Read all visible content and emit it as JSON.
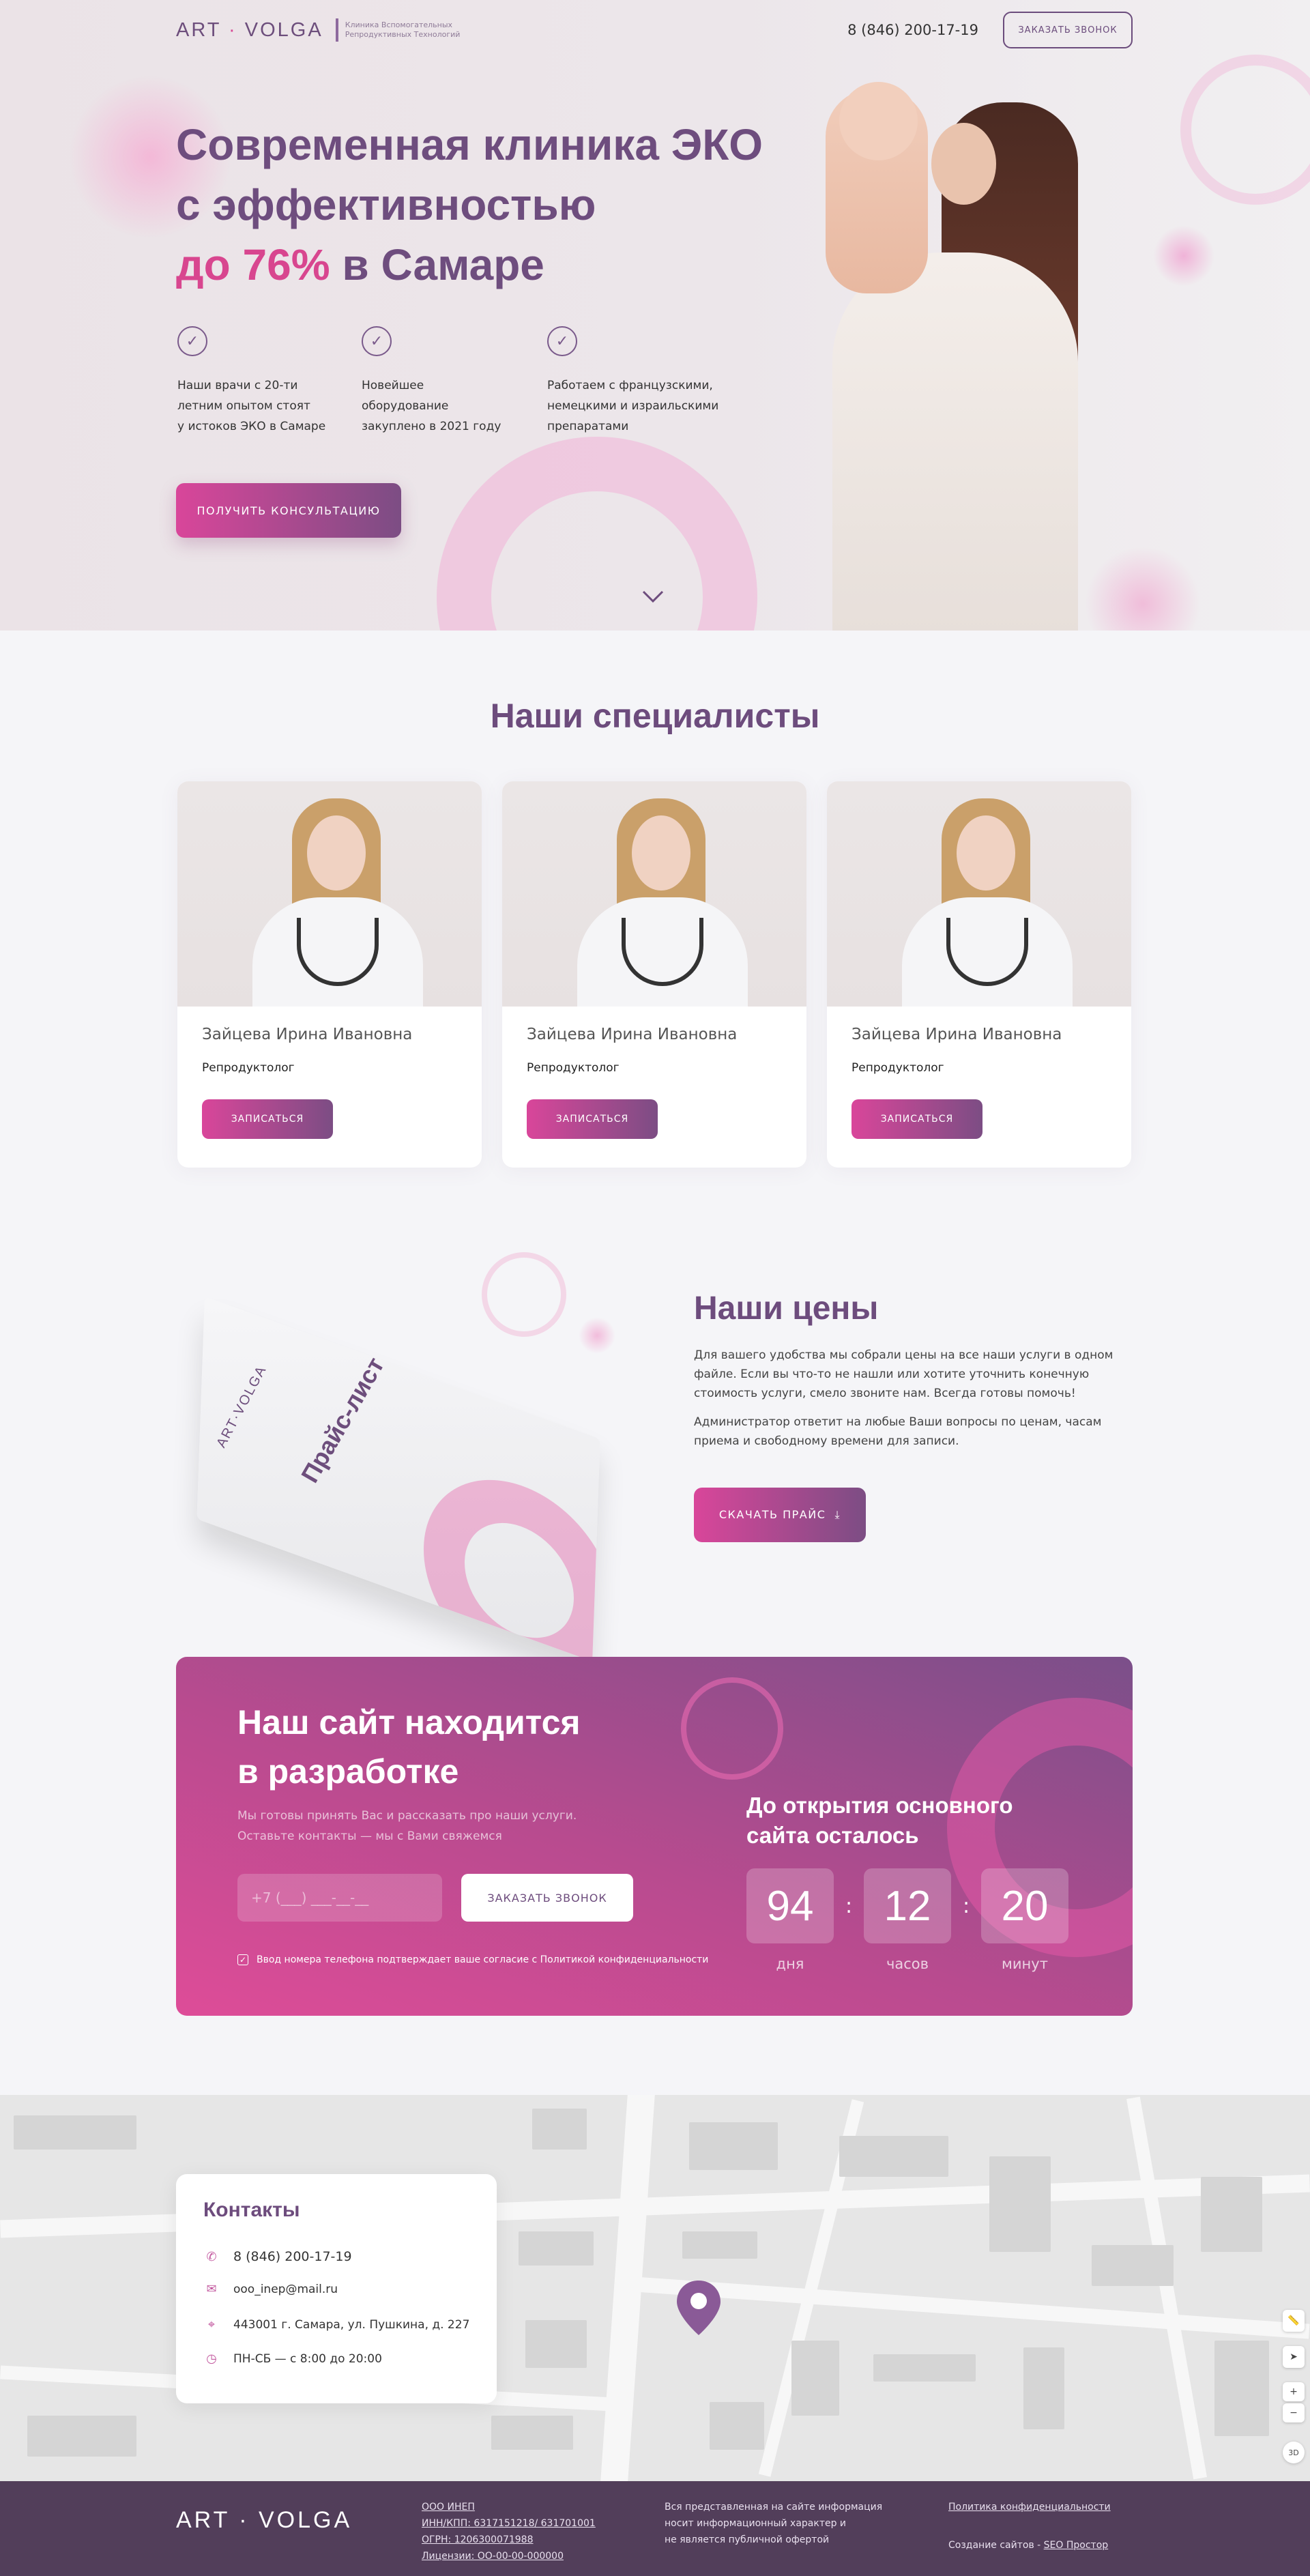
{
  "header": {
    "logo_left": "ART",
    "logo_dot": "·",
    "logo_right": "VOLGA",
    "logo_subtitle": "Клиника Вспомогательных Репродуктивных Технологий",
    "phone": "8 (846) 200-17-19",
    "callback_button": "ЗАКАЗАТЬ ЗВОНОК"
  },
  "hero": {
    "title_line1": "Современная клиника ЭКО",
    "title_line2": "с эффективностью",
    "title_highlight": "до 76%",
    "title_rest": " в Самаре",
    "features": [
      {
        "text": "Наши врачи с 20-ти\nлетним опытом стоят\nу истоков ЭКО в Самаре"
      },
      {
        "text": "Новейшее\nоборудование\nзакуплено в 2021 году"
      },
      {
        "text": "Работаем с французскими,\nнемецкими и израильскими\nпрепаратами"
      }
    ],
    "cta_button": "ПОЛУЧИТЬ КОНСУЛЬТАЦИЮ"
  },
  "specialists": {
    "title": "Наши специалисты",
    "cards": [
      {
        "name": "Зайцева Ирина Ивановна",
        "role": "Репродуктолог",
        "button": "ЗАПИСАТЬСЯ"
      },
      {
        "name": "Зайцева Ирина Ивановна",
        "role": "Репродуктолог",
        "button": "ЗАПИСАТЬСЯ"
      },
      {
        "name": "Зайцева Ирина Ивановна",
        "role": "Репродуктолог",
        "button": "ЗАПИСАТЬСЯ"
      }
    ]
  },
  "prices": {
    "book_logo": "ART·VOLGA",
    "book_title": "Прайс-лист",
    "title": "Наши цены",
    "paragraph1": "Для вашего удобства мы собрали цены на все наши услуги в одном файле. Если вы что-то не нашли или хотите уточнить конечную стоимость услуги, смело звоните нам. Всегда готовы помочь!",
    "paragraph2": "Администратор ответит на любые Ваши вопросы по ценам, часам приема и свободному времени для записи.",
    "download_button": "СКАЧАТЬ ПРАЙС"
  },
  "dev_banner": {
    "title": "Наш сайт находится\nв разработке",
    "subtitle": "Мы готовы принять Вас и рассказать про наши услуги.\nОставьте контакты — мы с Вами свяжемся",
    "phone_placeholder": "+7 (___) ___-__-__",
    "callback_button": "ЗАКАЗАТЬ ЗВОНОК",
    "consent_text": "Ввод номера телефона подтверждает ваше согласие с Политикой конфиденциальности",
    "timer_title": "До открытия основного\nсайта осталось",
    "timer": [
      {
        "value": "94",
        "label": "дня"
      },
      {
        "value": "12",
        "label": "часов"
      },
      {
        "value": "20",
        "label": "минут"
      }
    ]
  },
  "contacts": {
    "title": "Контакты",
    "phone": "8 (846) 200-17-19",
    "email": "ooo_inep@mail.ru",
    "address": "443001 г. Самара, ул. Пушкина, д. 227",
    "hours": "ПН-СБ — с 8:00 до 20:00"
  },
  "map": {
    "controls": [
      "ruler-icon",
      "navigate-icon",
      "zoom-in-icon",
      "zoom-out-icon"
    ],
    "zoom_in": "+",
    "zoom_out": "−",
    "mode_3d": "3D"
  },
  "footer": {
    "logo": "ART · VOLGA",
    "company": "ООО ИНЕП",
    "inn": "ИНН/КПП: 6317151218/ 631701001",
    "ogrn": "ОГРН: 1206300071988",
    "license": "Лицензии: ОО-00-00-000000",
    "disclaimer": "Вся представленная на сайте информация\nносит информационный характер и\nне является публичной офертой",
    "privacy_link": "Политика конфиденциальности",
    "credits_prefix": "Создание сайтов - ",
    "credits_link": "SEO Простор"
  },
  "colors": {
    "accent_purple": "#6d4c7d",
    "accent_pink": "#d8468f",
    "footer_bg": "#523e5a"
  }
}
